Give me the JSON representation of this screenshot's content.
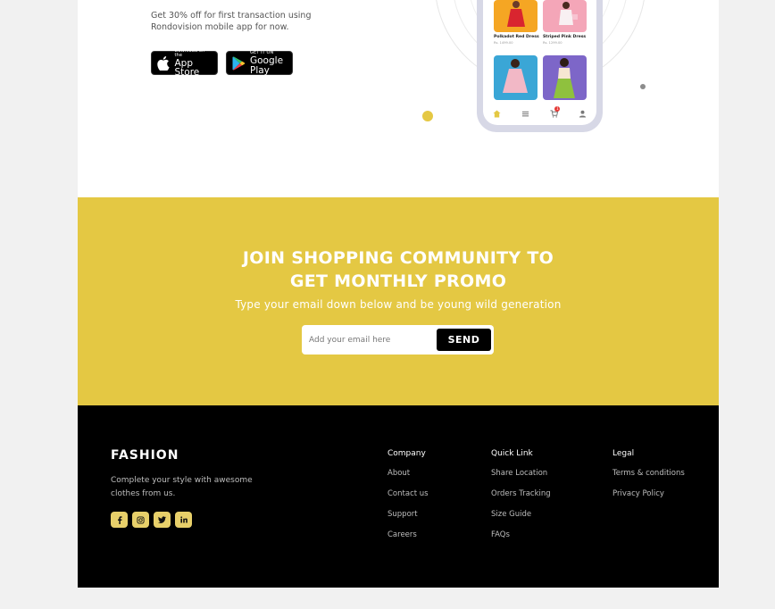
{
  "download": {
    "promo_text": "Get 30% off for first transaction using Rondovision mobile app for now.",
    "app_store": {
      "small": "Download on the",
      "big": "App Store"
    },
    "google_play": {
      "small": "GET IT ON",
      "big": "Google Play"
    }
  },
  "phone": {
    "products": [
      {
        "name": "Polkadot Red Dress",
        "price": "Rs. 1499.00"
      },
      {
        "name": "Striped Pink Dress",
        "price": "Rs. 1299.00"
      },
      {
        "name": "",
        "price": ""
      },
      {
        "name": "",
        "price": ""
      }
    ],
    "cart_badge": "1"
  },
  "newsletter": {
    "title_line1": "JOIN SHOPPING COMMUNITY TO",
    "title_line2": "GET MONTHLY PROMO",
    "subtitle": "Type your email down below and be young wild generation",
    "email_placeholder": "Add your email here",
    "email_value": "",
    "send_label": "SEND"
  },
  "footer": {
    "brand": "FASHION",
    "tagline": "Complete your style with awesome clothes from us.",
    "socials": [
      "facebook-icon",
      "instagram-icon",
      "twitter-icon",
      "linkedin-icon"
    ],
    "columns": [
      {
        "heading": "Company",
        "links": [
          "About",
          "Contact us",
          "Support",
          "Careers"
        ]
      },
      {
        "heading": "Quick Link",
        "links": [
          "Share Location",
          "Orders Tracking",
          "Size Guide",
          "FAQs"
        ]
      },
      {
        "heading": "Legal",
        "links": [
          "Terms & conditions",
          "Privacy Policy"
        ]
      }
    ]
  },
  "colors": {
    "accent_yellow": "#e4c843",
    "footer_bg": "#000000",
    "page_bg": "#f1f1f1"
  }
}
